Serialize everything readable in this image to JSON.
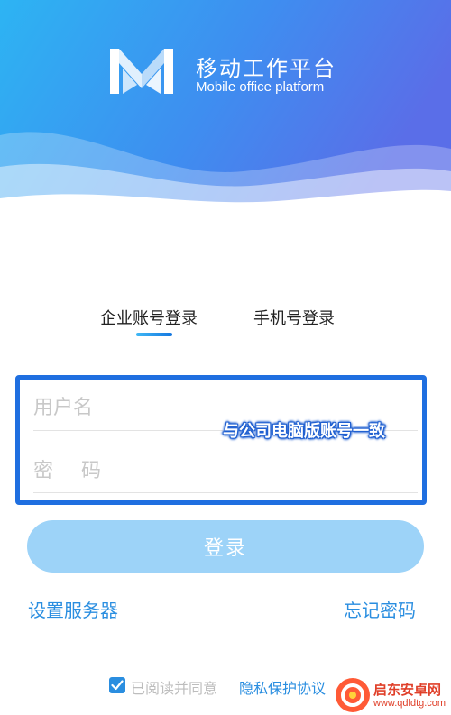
{
  "header": {
    "app_title": "移动工作平台",
    "app_subtitle": "Mobile office platform"
  },
  "tabs": [
    {
      "label": "企业账号登录",
      "active": true
    },
    {
      "label": "手机号登录",
      "active": false
    }
  ],
  "form": {
    "username_placeholder": "用户名",
    "password_placeholder": "密 码",
    "callout": "与公司电脑版账号一致",
    "login_label": "登录"
  },
  "links": {
    "server": "设置服务器",
    "forgot": "忘记密码"
  },
  "agreement": {
    "checked": true,
    "text": "已阅读并同意",
    "link": "隐私保护协议"
  },
  "watermark": {
    "name": "启东安卓网",
    "url": "www.qdldtg.com"
  },
  "colors": {
    "accent": "#2a8ee0",
    "frame": "#1f6fe0",
    "button": "#9dd3f8"
  }
}
